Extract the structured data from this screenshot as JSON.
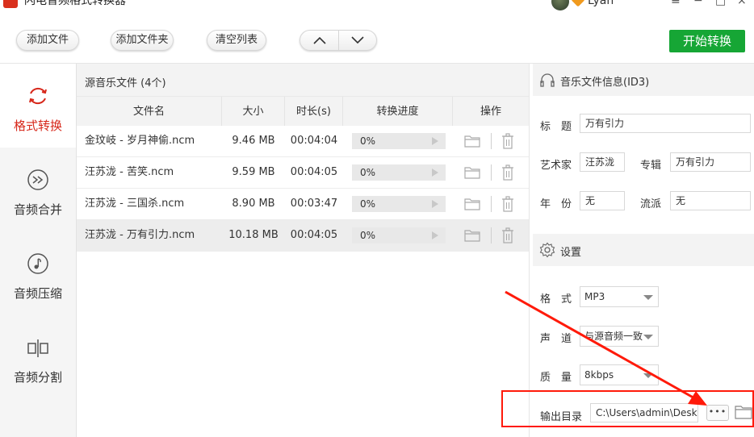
{
  "app": {
    "title": "闪电音频格式转换器",
    "user_name": "Lyan"
  },
  "toolbar": {
    "add_file": "添加文件",
    "add_folder": "添加文件夹",
    "clear_list": "清空列表",
    "start_convert": "开始转换"
  },
  "sidebar": {
    "items": [
      {
        "label": "格式转换",
        "icon": "refresh-icon",
        "active": true
      },
      {
        "label": "音频合并",
        "icon": "merge-icon",
        "active": false
      },
      {
        "label": "音频压缩",
        "icon": "music-note-icon",
        "active": false
      },
      {
        "label": "音频分割",
        "icon": "split-icon",
        "active": false
      }
    ]
  },
  "files": {
    "header": "源音乐文件 (4个)",
    "columns": [
      "文件名",
      "大小",
      "时长(s)",
      "转换进度",
      "操作"
    ],
    "rows": [
      {
        "name": "金玟岐 - 岁月神偷.ncm",
        "size": "9.46 MB",
        "duration": "00:04:04",
        "progress": "0%",
        "selected": false
      },
      {
        "name": "汪苏泷 - 苦笑.ncm",
        "size": "9.59 MB",
        "duration": "00:04:05",
        "progress": "0%",
        "selected": false
      },
      {
        "name": "汪苏泷 - 三国杀.ncm",
        "size": "8.90 MB",
        "duration": "00:03:47",
        "progress": "0%",
        "selected": false
      },
      {
        "name": "汪苏泷 - 万有引力.ncm",
        "size": "10.18 MB",
        "duration": "00:04:05",
        "progress": "0%",
        "selected": true
      }
    ]
  },
  "info": {
    "header": "音乐文件信息(ID3)",
    "title_label": "标　题",
    "title_value": "万有引力",
    "artist_label": "艺术家",
    "artist_value": "汪苏泷",
    "album_label": "专辑",
    "album_value": "万有引力",
    "year_label": "年　份",
    "year_value": "无",
    "genre_label": "流派",
    "genre_value": "无"
  },
  "settings": {
    "header": "设置",
    "format_label": "格　式",
    "format_value": "MP3",
    "channel_label": "声　道",
    "channel_value": "与源音频一致",
    "quality_label": "质　量",
    "quality_value": "8kbps",
    "output_label": "输出目录",
    "output_value": "C:\\Users\\admin\\Desktop",
    "browse_label": "•••"
  },
  "colors": {
    "accent_red": "#d7281b",
    "start_green": "#16a635",
    "annotation_red": "#ff1a0a"
  }
}
